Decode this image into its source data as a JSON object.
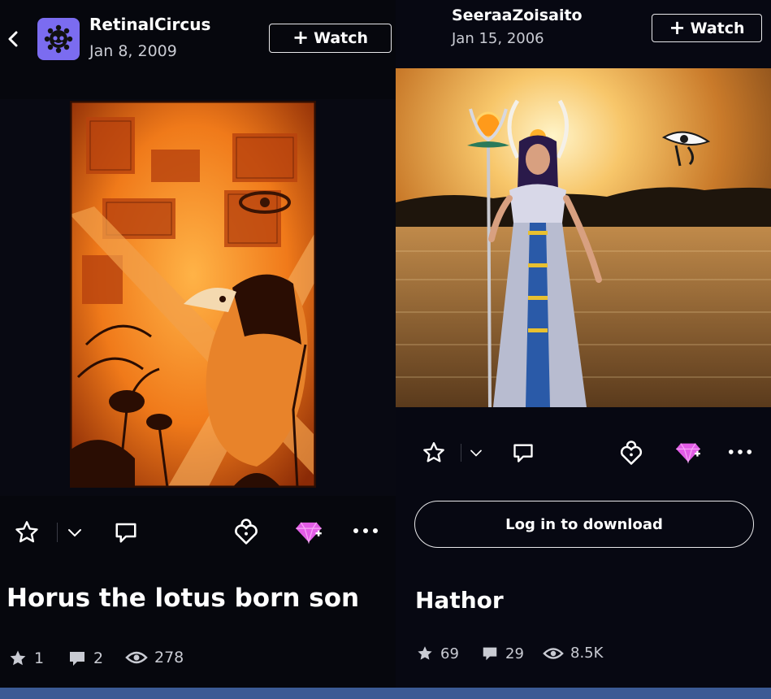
{
  "left_post": {
    "author": "RetinalCircus",
    "date": "Jan 8, 2009",
    "watch_label": "Watch",
    "title": "Horus the lotus born son",
    "stats": {
      "favorites": "1",
      "comments": "2",
      "views": "278"
    }
  },
  "right_post": {
    "author": "SeeraaZoisaito",
    "date": "Jan 15, 2006",
    "watch_label": "Watch",
    "download_label": "Log in to download",
    "title": "Hathor",
    "stats": {
      "favorites": "69",
      "comments": "29",
      "views": "8.5K"
    }
  },
  "colors": {
    "background": "#06070d",
    "avatar": "#7b6cf0",
    "gem": "#e25ce6",
    "bottom_strip": "#3b5a94"
  },
  "icons": [
    "back-icon",
    "star-icon",
    "chevron-down-icon",
    "comment-icon",
    "heart-lock-icon",
    "gem-icon",
    "more-icon",
    "eye-icon"
  ]
}
